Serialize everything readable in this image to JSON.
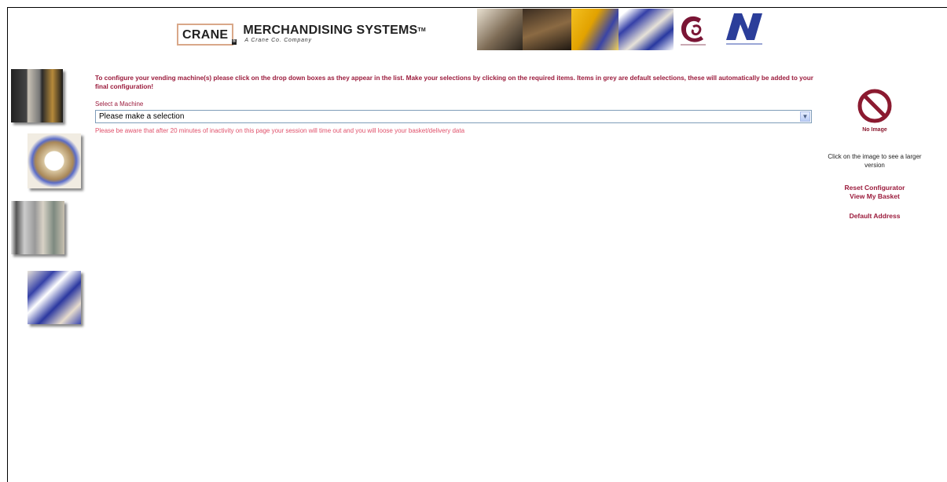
{
  "header": {
    "brand_box": "CRANE",
    "brand_title": "MERCHANDISING SYSTEMS",
    "trademark": "TM",
    "tagline": "A Crane Co. Company"
  },
  "intro": {
    "text": "To configure your vending machine(s) please click on the drop down boxes as they appear in the list. Make your selections by clicking on the required items. Items in grey are default selections, these will automatically be added to your final configuration!"
  },
  "machine_select": {
    "label": "Select a Machine",
    "value": "Please make a selection"
  },
  "warning": {
    "text": "Please be aware that after 20 minutes of inactivity on this page your session will time out and you will loose your basket/delivery data"
  },
  "preview": {
    "no_image_label": "No Image",
    "click_note": "Click on the image to see a larger version"
  },
  "links": {
    "reset": "Reset Configurator",
    "basket": "View My Basket",
    "address": "Default Address"
  },
  "colors": {
    "accent": "#9b1b3c",
    "warning": "#e0506a",
    "no_image_icon": "#8b1a30"
  }
}
